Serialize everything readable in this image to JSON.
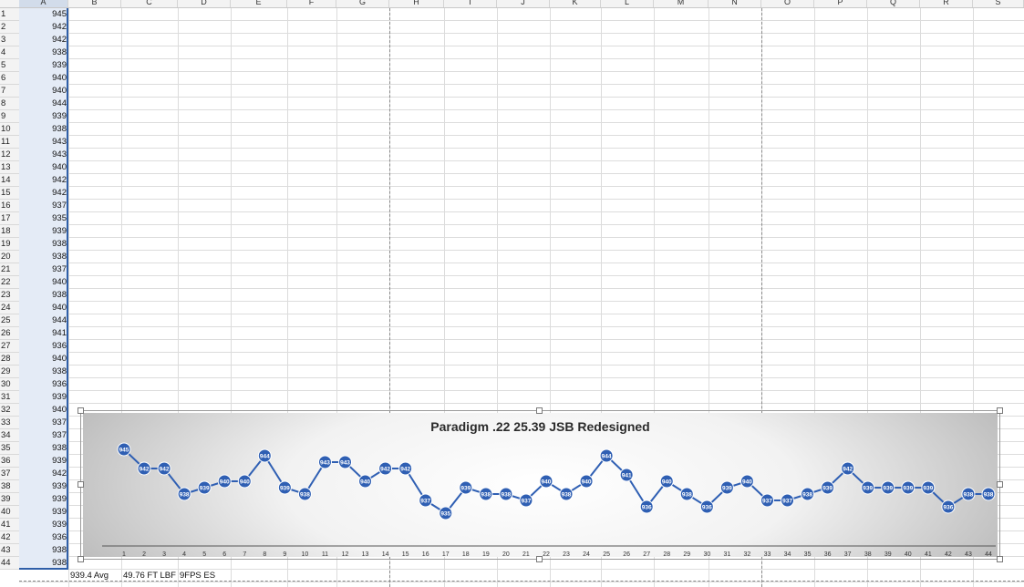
{
  "columns": [
    "A",
    "B",
    "C",
    "D",
    "E",
    "F",
    "G",
    "H",
    "I",
    "J",
    "K",
    "L",
    "M",
    "N",
    "O",
    "P",
    "Q",
    "R",
    "S"
  ],
  "rows": [
    "1",
    "2",
    "3",
    "4",
    "5",
    "6",
    "7",
    "8",
    "9",
    "10",
    "11",
    "12",
    "13",
    "14",
    "15",
    "16",
    "17",
    "18",
    "19",
    "20",
    "21",
    "22",
    "23",
    "24",
    "25",
    "26",
    "27",
    "28",
    "29",
    "30",
    "31",
    "32",
    "33",
    "34",
    "35",
    "36",
    "37",
    "38",
    "39",
    "40",
    "41",
    "42",
    "43",
    "44"
  ],
  "column_a_values": [
    "945",
    "942",
    "942",
    "938",
    "939",
    "940",
    "940",
    "944",
    "939",
    "938",
    "943",
    "943",
    "940",
    "942",
    "942",
    "937",
    "935",
    "939",
    "938",
    "938",
    "937",
    "940",
    "938",
    "940",
    "944",
    "941",
    "936",
    "940",
    "938",
    "936",
    "939",
    "940",
    "937",
    "937",
    "938",
    "939",
    "942",
    "939",
    "939",
    "939",
    "939",
    "936",
    "938",
    "938"
  ],
  "footer": {
    "b": "939.4 Avg",
    "c": "49.76 FT LBF",
    "d": "9FPS ES"
  },
  "chart_data": {
    "type": "line",
    "title": "Paradigm .22 25.39 JSB Redesigned",
    "categories": [
      "1",
      "2",
      "3",
      "4",
      "5",
      "6",
      "7",
      "8",
      "9",
      "10",
      "11",
      "12",
      "13",
      "14",
      "15",
      "16",
      "17",
      "18",
      "19",
      "20",
      "21",
      "22",
      "23",
      "24",
      "25",
      "26",
      "27",
      "28",
      "29",
      "30",
      "31",
      "32",
      "33",
      "34",
      "35",
      "36",
      "37",
      "38",
      "39",
      "40",
      "41",
      "42",
      "43",
      "44"
    ],
    "series": [
      {
        "values": [
          945,
          942,
          942,
          938,
          939,
          940,
          940,
          944,
          939,
          938,
          943,
          943,
          940,
          942,
          942,
          937,
          935,
          939,
          938,
          938,
          937,
          940,
          938,
          940,
          944,
          941,
          936,
          940,
          938,
          936,
          939,
          940,
          937,
          937,
          938,
          939,
          942,
          939,
          939,
          939,
          939,
          936,
          938,
          938
        ]
      }
    ],
    "data_labels": true,
    "ylim": [
      935,
      945
    ],
    "line_color": "#2f5fb3",
    "marker_color": "#2f5fb3",
    "grid": false,
    "legend": "none"
  }
}
